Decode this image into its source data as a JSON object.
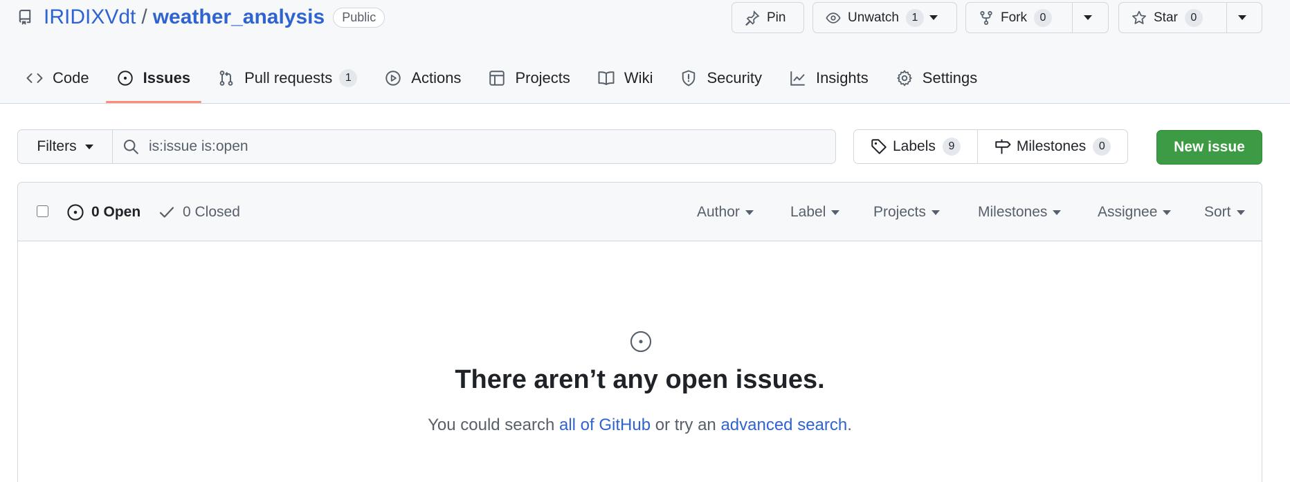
{
  "repo": {
    "owner": "IRIDIXVdt",
    "separator": "/",
    "name": "weather_analysis",
    "visibility": "Public"
  },
  "actions": {
    "pin": "Pin",
    "unwatch": "Unwatch",
    "watch_count": "1",
    "fork": "Fork",
    "fork_count": "0",
    "star": "Star",
    "star_count": "0"
  },
  "tabs": [
    {
      "label": "Code"
    },
    {
      "label": "Issues"
    },
    {
      "label": "Pull requests",
      "count": "1"
    },
    {
      "label": "Actions"
    },
    {
      "label": "Projects"
    },
    {
      "label": "Wiki"
    },
    {
      "label": "Security"
    },
    {
      "label": "Insights"
    },
    {
      "label": "Settings"
    }
  ],
  "filterbar": {
    "filters_label": "Filters",
    "search_value": "is:issue is:open",
    "labels_label": "Labels",
    "labels_count": "9",
    "milestones_label": "Milestones",
    "milestones_count": "0",
    "new_issue_label": "New issue"
  },
  "list_header": {
    "open_label": "0 Open",
    "closed_label": "0 Closed",
    "filters": [
      "Author",
      "Label",
      "Projects",
      "Milestones",
      "Assignee",
      "Sort"
    ]
  },
  "blankslate": {
    "title": "There aren’t any open issues.",
    "text_before": "You could search ",
    "link1": "all of GitHub",
    "text_middle": " or try an ",
    "link2": "advanced search",
    "text_after": "."
  },
  "colors": {
    "accent_link": "#2f63cf",
    "primary_button": "#3c9b44",
    "tab_underline": "#fd8c73"
  }
}
